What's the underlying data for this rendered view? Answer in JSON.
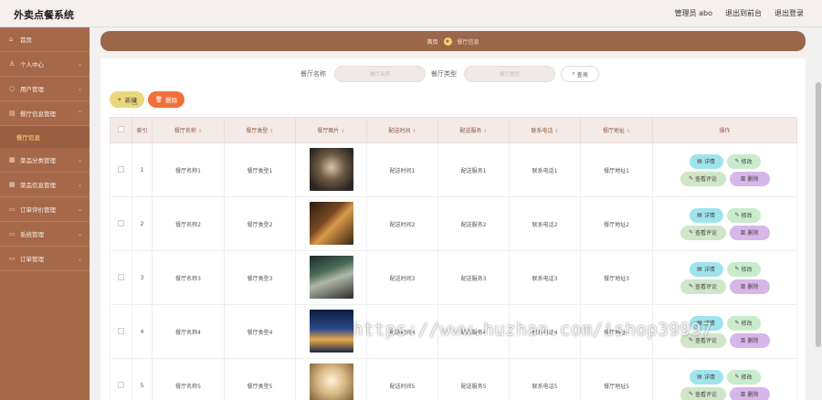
{
  "app": {
    "title": "外卖点餐系统"
  },
  "header": {
    "admin_label": "管理员 abo",
    "back_label": "退出到前台",
    "logout_label": "退出登录"
  },
  "sidebar": {
    "items": [
      {
        "label": "首页",
        "icon": "home-icon"
      },
      {
        "label": "个人中心",
        "icon": "user-icon"
      },
      {
        "label": "用户管理",
        "icon": "users-icon"
      },
      {
        "label": "餐厅信息管理",
        "icon": "store-icon"
      },
      {
        "label": "菜品分类管理",
        "icon": "category-icon"
      },
      {
        "label": "菜品信息管理",
        "icon": "dish-icon"
      },
      {
        "label": "订单评价管理",
        "icon": "comment-icon"
      },
      {
        "label": "系统管理",
        "icon": "system-icon"
      },
      {
        "label": "订单管理",
        "icon": "order-icon"
      }
    ],
    "active_sub": "餐厅信息"
  },
  "breadcrumb": {
    "home": "首页",
    "current": "餐厅信息"
  },
  "search": {
    "name_label": "餐厅名称",
    "name_placeholder": "餐厅名称",
    "type_label": "餐厅类型",
    "type_placeholder": "餐厅类型",
    "query_label": "查询"
  },
  "toolbar": {
    "add_label": "新增",
    "delete_label": "删除"
  },
  "table": {
    "headers": [
      "索引",
      "餐厅名称",
      "餐厅类型",
      "餐厅图片",
      "配送时间",
      "配送服务",
      "联系电话",
      "餐厅地址",
      "操作"
    ],
    "rows": [
      {
        "index": "1",
        "name": "餐厅名称1",
        "type": "餐厅类型1",
        "time": "配送时间1",
        "service": "配送服务1",
        "phone": "联系电话1",
        "address": "餐厅地址1"
      },
      {
        "index": "2",
        "name": "餐厅名称2",
        "type": "餐厅类型2",
        "time": "配送时间2",
        "service": "配送服务2",
        "phone": "联系电话2",
        "address": "餐厅地址2"
      },
      {
        "index": "3",
        "name": "餐厅名称3",
        "type": "餐厅类型3",
        "time": "配送时间3",
        "service": "配送服务3",
        "phone": "联系电话3",
        "address": "餐厅地址3"
      },
      {
        "index": "4",
        "name": "餐厅名称4",
        "type": "餐厅类型4",
        "time": "配送时间4",
        "service": "配送服务4",
        "phone": "联系电话4",
        "address": "餐厅地址4"
      },
      {
        "index": "5",
        "name": "餐厅名称5",
        "type": "餐厅类型5",
        "time": "配送时间5",
        "service": "配送服务5",
        "phone": "联系电话5",
        "address": "餐厅地址5"
      }
    ],
    "actions": {
      "detail": "详情",
      "edit": "修改",
      "comment": "查看评论",
      "delete": "删除"
    }
  },
  "watermark": "https://www.huzhan.com/ishop39997",
  "colors": {
    "sidebar": "#a5694a",
    "breadcrumb": "#9b674b",
    "accent_yellow": "#e9d77a",
    "danger": "#f0703c"
  }
}
